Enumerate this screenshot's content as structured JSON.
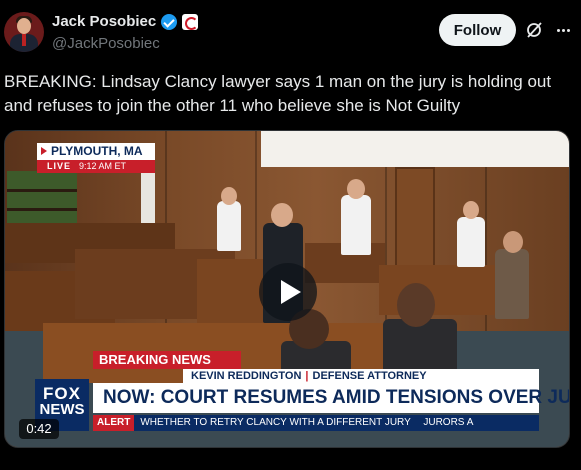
{
  "author": {
    "display_name": "Jack Posobiec",
    "handle": "@JackPosobiec"
  },
  "actions": {
    "follow_label": "Follow"
  },
  "post": {
    "text": "BREAKING: Lindsay Clancy lawyer says 1 man on the jury is holding out and refuses to join the other 11 who believe she is Not Guilty"
  },
  "video": {
    "duration": "0:42",
    "location": "PLYMOUTH, MA",
    "live_label": "LIVE",
    "live_time": "9:12 AM ET",
    "breaking_label": "BREAKING NEWS",
    "speaker_name": "KEVIN REDDINGTON",
    "speaker_title": "DEFENSE ATTORNEY",
    "headline": "NOW: COURT RESUMES AMID TENSIONS OVER JURY",
    "ticker_alert": "ALERT",
    "ticker_text": "WHETHER TO RETRY CLANCY WITH A DIFFERENT JURY",
    "ticker_tail": "JURORS A",
    "network_logo_line1": "FOX",
    "network_logo_line2": "NEWS"
  },
  "icons": {
    "verified": "verified-badge-icon",
    "affiliate": "affiliate-badge-icon",
    "grok": "grok-icon",
    "more": "more-icon",
    "play": "play-icon"
  },
  "colors": {
    "background": "#000000",
    "text": "#e7e9ea",
    "secondary_text": "#71767b",
    "verified_blue": "#1d9bf0",
    "fox_red": "#c81f2a",
    "fox_navy": "#0a2b63"
  }
}
